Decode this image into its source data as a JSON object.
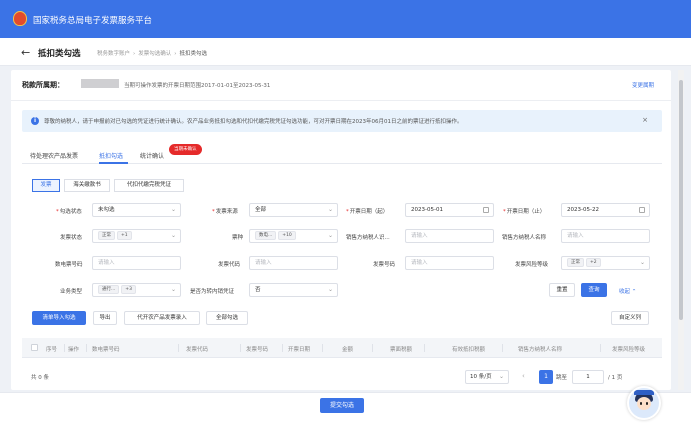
{
  "app": {
    "title": "国家税务总局电子发票服务平台"
  },
  "header": {
    "back_icon": "arrow-left-icon",
    "page_title": "抵扣类勾选",
    "breadcrumb": [
      "税务数字账户",
      "发票勾选确认",
      "抵扣类勾选"
    ]
  },
  "period": {
    "label": "税款所属期：",
    "hint": "当期可操作发票的开票日期范围2017-01-01至2023-05-31",
    "change_link": "变更属期"
  },
  "notice": {
    "icon": "info-icon",
    "text": "尊敬的纳税人，请于申报前对已勾选的凭证进行统计确认。农产品业务抵扣勾选和代扣代缴完税凭证勾选功能，可对开票日期在2023年06月01日之前的票证进行抵扣操作。",
    "close": "×"
  },
  "tabs": {
    "items": [
      "待处理农产品发票",
      "抵扣勾选",
      "统计确认"
    ],
    "active": 1,
    "badge": "当期未确认"
  },
  "subtabs": {
    "items": [
      "发票",
      "海关缴款书",
      "代扣代缴完税凭证"
    ],
    "active": 0
  },
  "filters": {
    "check_status": {
      "label": "勾选状态",
      "value": "未勾选"
    },
    "invoice_source": {
      "label": "发票来源",
      "value": "全部"
    },
    "date_from": {
      "label": "开票日期（起）",
      "value": "2023-05-01"
    },
    "date_to": {
      "label": "开票日期（止）",
      "value": "2023-05-22"
    },
    "invoice_status": {
      "label": "发票状态",
      "tag": "正常",
      "more": "+1"
    },
    "ticket_type": {
      "label": "票种",
      "tag": "数电...",
      "more": "+10"
    },
    "seller_tax_id": {
      "label": "销售方纳税人识...",
      "placeholder": "请输入"
    },
    "seller_name": {
      "label": "销售方纳税人名称",
      "placeholder": "请输入"
    },
    "digital_invoice_no": {
      "label": "数电票号码",
      "placeholder": "请输入"
    },
    "invoice_code": {
      "label": "发票代码",
      "placeholder": "请输入"
    },
    "invoice_number": {
      "label": "发票号码",
      "placeholder": "请输入"
    },
    "risk_level": {
      "label": "发票风险等级",
      "tag": "正常",
      "more": "+2"
    },
    "business_type": {
      "label": "业务类型",
      "tag": "通行...",
      "more": "+3"
    },
    "transfer_out": {
      "label": "是否为转内销凭证",
      "value": "否"
    },
    "reset_label": "重置",
    "query_label": "查询",
    "collapse_label": "收起"
  },
  "actions": {
    "import_check": "清单导入勾选",
    "export": "导出",
    "agri_entry": "代开农产品发票录入",
    "check_all": "全部勾选",
    "custom_columns": "自定义列"
  },
  "table": {
    "columns": [
      "序号",
      "操作",
      "数电票号码",
      "发票代码",
      "发票号码",
      "开票日期",
      "金额",
      "票面税额",
      "有效抵扣税额",
      "销售方纳税人名称",
      "发票风险等级"
    ]
  },
  "pagination": {
    "total": "共 0 条",
    "page_size": "10 条/页",
    "current_page": "1",
    "goto_label": "跳至",
    "goto_value": "1",
    "goto_suffix": "/ 1 页"
  },
  "footer": {
    "submit": "提交勾选"
  },
  "assistant": {
    "icon": "assistant-avatar-icon"
  }
}
